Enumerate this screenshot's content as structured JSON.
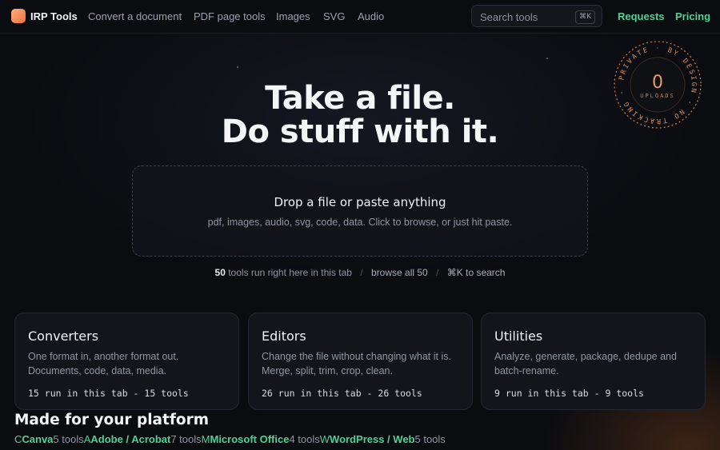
{
  "nav": {
    "brand": "IRP Tools",
    "links": [
      "Convert a document",
      "PDF page tools",
      "Images",
      "SVG",
      "Audio"
    ],
    "search_placeholder": "Search tools",
    "search_shortcut": "⌘K",
    "requests": "Requests",
    "pricing": "Pricing",
    "accent_color": "#4fd19a"
  },
  "badge": {
    "count": "0",
    "label": "UPLOADS",
    "ring_text": "PRIVATE · BY DESIGN · NO TRACKING ·"
  },
  "hero": {
    "line1": "Take a file.",
    "line2": "Do stuff with it."
  },
  "drop": {
    "title": "Drop a file or paste anything",
    "subtitle": "pdf, images, audio, svg, code, data. Click to browse, or just hit paste."
  },
  "meta": {
    "count": "50",
    "count_text": "tools run right here in this tab",
    "browse": "browse all 50",
    "search_hint": "⌘K to search"
  },
  "cards": [
    {
      "title": "Converters",
      "desc": "One format in, another format out. Documents, code, data, media.",
      "foot": "15 run in this tab - 15 tools"
    },
    {
      "title": "Editors",
      "desc": "Change the file without changing what it is. Merge, split, trim, crop, clean.",
      "foot": "26 run in this tab - 26 tools"
    },
    {
      "title": "Utilities",
      "desc": "Analyze, generate, package, dedupe and batch-rename.",
      "foot": "9 run in this tab - 9 tools"
    }
  ],
  "platforms": {
    "title": "Made for your platform",
    "items": [
      {
        "icon": "C",
        "name": "Canva",
        "count": "5 tools"
      },
      {
        "icon": "A",
        "name": "Adobe / Acrobat",
        "count": "7 tools"
      },
      {
        "icon": "M",
        "name": "Microsoft Office",
        "count": "4 tools"
      },
      {
        "icon": "W",
        "name": "WordPress / Web",
        "count": "5 tools"
      }
    ]
  }
}
